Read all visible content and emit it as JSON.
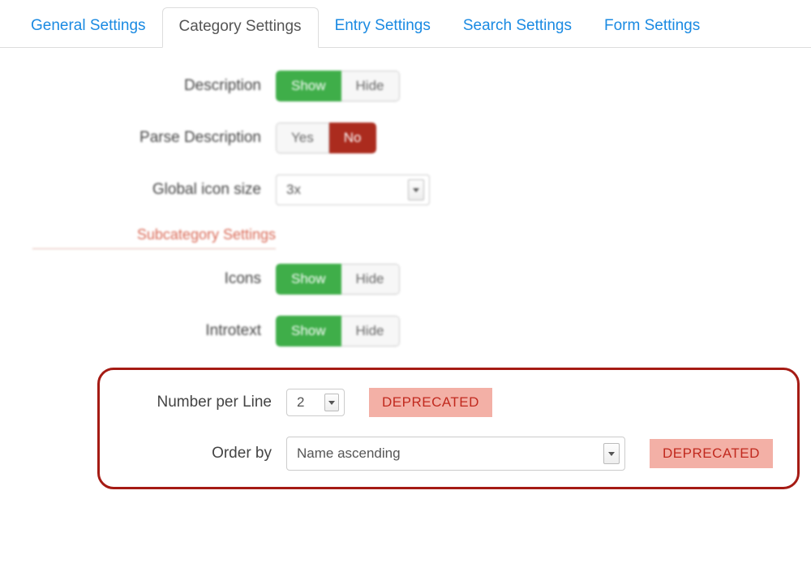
{
  "tabs": [
    {
      "label": "General Settings",
      "active": false
    },
    {
      "label": "Category Settings",
      "active": true
    },
    {
      "label": "Entry Settings",
      "active": false
    },
    {
      "label": "Search Settings",
      "active": false
    },
    {
      "label": "Form Settings",
      "active": false
    }
  ],
  "rows": {
    "description": {
      "label": "Description",
      "option_on": "Show",
      "option_off": "Hide",
      "value": "Show"
    },
    "parse_description": {
      "label": "Parse Description",
      "option_on": "Yes",
      "option_off": "No",
      "value": "No"
    },
    "global_icon_size": {
      "label": "Global icon size",
      "value": "3x"
    }
  },
  "section_heading": "Subcategory Settings",
  "sub_rows": {
    "icons": {
      "label": "Icons",
      "option_on": "Show",
      "option_off": "Hide",
      "value": "Show"
    },
    "introtext": {
      "label": "Introtext",
      "option_on": "Show",
      "option_off": "Hide",
      "value": "Show"
    }
  },
  "deprecated": {
    "number_per_line": {
      "label": "Number per Line",
      "value": "2",
      "badge": "DEPRECATED"
    },
    "order_by": {
      "label": "Order by",
      "value": "Name ascending",
      "badge": "DEPRECATED"
    }
  }
}
